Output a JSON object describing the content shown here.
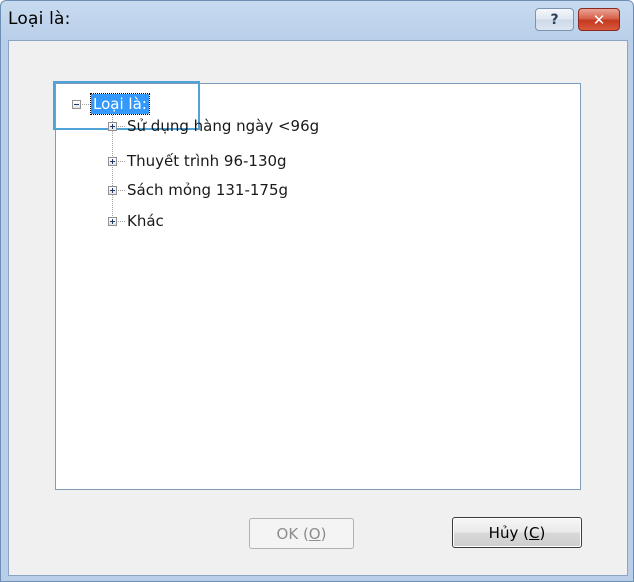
{
  "window": {
    "title": "Loại là:",
    "help_glyph": "?",
    "close_glyph": "✕"
  },
  "tree": {
    "root": {
      "label": "Loại là:",
      "expanded": true,
      "selected": true
    },
    "children": [
      {
        "label": "Sử dụng hàng ngày <96g",
        "expanded": false
      },
      {
        "label": "Thuyết trình 96-130g",
        "expanded": false
      },
      {
        "label": "Sách mỏng 131-175g",
        "expanded": false
      },
      {
        "label": "Khác",
        "expanded": false
      }
    ]
  },
  "buttons": {
    "ok": {
      "text": "OK (",
      "mnemonic": "O",
      "suffix": ")",
      "enabled": false
    },
    "cancel": {
      "text": "Hủy (",
      "mnemonic": "C",
      "suffix": ")",
      "enabled": true
    }
  },
  "colors": {
    "frame": "#b9cfe9",
    "selection": "#3399ff",
    "focus": "#4ea3d9",
    "close": "#c6391f"
  },
  "icons": {
    "help": "help-icon",
    "close": "close-icon",
    "collapse": "minus-box-icon",
    "expand": "plus-box-icon"
  }
}
